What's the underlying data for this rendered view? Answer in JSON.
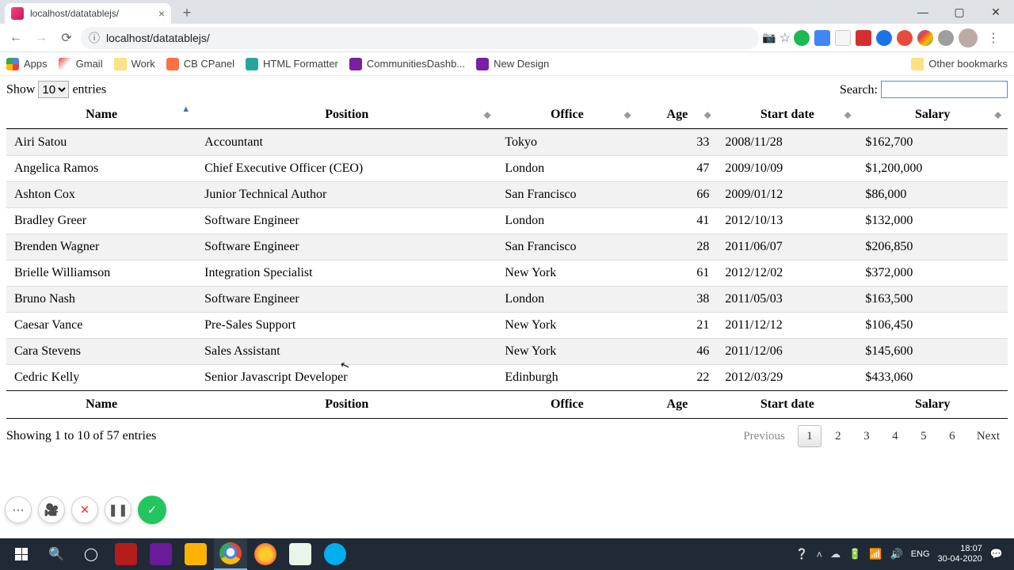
{
  "browser": {
    "tab_title": "localhost/datatablejs/",
    "url": "localhost/datatablejs/",
    "window_controls": [
      "minimize",
      "maximize",
      "close"
    ]
  },
  "bookmarks": {
    "items": [
      {
        "label": "Apps",
        "icon": "apps"
      },
      {
        "label": "Gmail",
        "icon": "gmail"
      },
      {
        "label": "Work",
        "icon": "folder"
      },
      {
        "label": "CB CPanel",
        "icon": "cb"
      },
      {
        "label": "HTML Formatter",
        "icon": "teal"
      },
      {
        "label": "CommunitiesDashb...",
        "icon": "xd"
      },
      {
        "label": "New Design",
        "icon": "xd"
      }
    ],
    "other": "Other bookmarks"
  },
  "datatable": {
    "length_prefix": "Show",
    "length_value": "10",
    "length_suffix": "entries",
    "search_label": "Search:",
    "search_value": "",
    "columns": [
      "Name",
      "Position",
      "Office",
      "Age",
      "Start date",
      "Salary"
    ],
    "sort_column": "Name",
    "sort_dir": "asc",
    "rows": [
      {
        "name": "Airi Satou",
        "position": "Accountant",
        "office": "Tokyo",
        "age": "33",
        "start": "2008/11/28",
        "salary": "$162,700"
      },
      {
        "name": "Angelica Ramos",
        "position": "Chief Executive Officer (CEO)",
        "office": "London",
        "age": "47",
        "start": "2009/10/09",
        "salary": "$1,200,000"
      },
      {
        "name": "Ashton Cox",
        "position": "Junior Technical Author",
        "office": "San Francisco",
        "age": "66",
        "start": "2009/01/12",
        "salary": "$86,000"
      },
      {
        "name": "Bradley Greer",
        "position": "Software Engineer",
        "office": "London",
        "age": "41",
        "start": "2012/10/13",
        "salary": "$132,000"
      },
      {
        "name": "Brenden Wagner",
        "position": "Software Engineer",
        "office": "San Francisco",
        "age": "28",
        "start": "2011/06/07",
        "salary": "$206,850"
      },
      {
        "name": "Brielle Williamson",
        "position": "Integration Specialist",
        "office": "New York",
        "age": "61",
        "start": "2012/12/02",
        "salary": "$372,000"
      },
      {
        "name": "Bruno Nash",
        "position": "Software Engineer",
        "office": "London",
        "age": "38",
        "start": "2011/05/03",
        "salary": "$163,500"
      },
      {
        "name": "Caesar Vance",
        "position": "Pre-Sales Support",
        "office": "New York",
        "age": "21",
        "start": "2011/12/12",
        "salary": "$106,450"
      },
      {
        "name": "Cara Stevens",
        "position": "Sales Assistant",
        "office": "New York",
        "age": "46",
        "start": "2011/12/06",
        "salary": "$145,600"
      },
      {
        "name": "Cedric Kelly",
        "position": "Senior Javascript Developer",
        "office": "Edinburgh",
        "age": "22",
        "start": "2012/03/29",
        "salary": "$433,060"
      }
    ],
    "info": "Showing 1 to 10 of 57 entries",
    "pagination": {
      "previous": "Previous",
      "next": "Next",
      "pages": [
        "1",
        "2",
        "3",
        "4",
        "5",
        "6"
      ],
      "current": "1"
    }
  },
  "recorder": {
    "buttons": [
      "more",
      "camera",
      "close",
      "pause",
      "ok"
    ]
  },
  "taskbar": {
    "lang": "ENG",
    "time": "18:07",
    "date": "30-04-2020"
  }
}
